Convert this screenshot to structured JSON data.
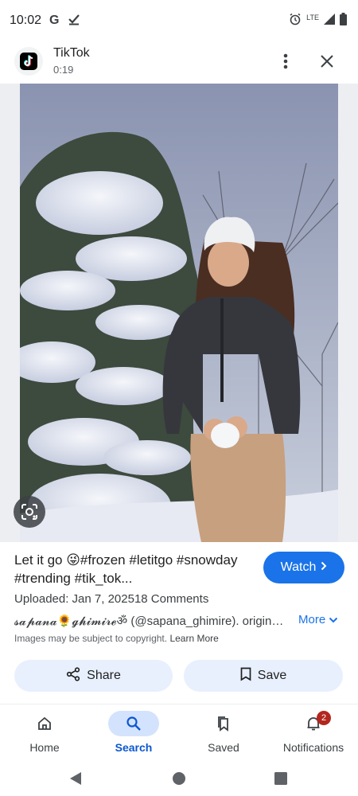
{
  "status_bar": {
    "time": "10:02",
    "g_label": "G",
    "network": "LTE"
  },
  "header": {
    "app_name": "TikTok",
    "duration": "0:19",
    "icons": {
      "more": "more-vert-icon",
      "close": "close-icon"
    }
  },
  "image": {
    "description_icon": "lens-icon"
  },
  "details": {
    "caption": "Let it go 😜#frozen #letitgo #snowday #trending #tik_tok...",
    "watch_label": "Watch",
    "uploaded": "Uploaded: Jan 7, 202518 Comments",
    "source": "𝓼𝓪𝓹𝓪𝓷𝓪🌻𝓰𝓱𝓲𝓶𝓲𝓻𝓮ॐ (@sapana_ghimire). original...",
    "more_label": "More",
    "copyright_text": "Images may be subject to copyright.",
    "learn_more": "Learn More",
    "share_label": "Share",
    "save_label": "Save"
  },
  "bottom_nav": {
    "items": [
      {
        "label": "Home",
        "icon": "home-icon"
      },
      {
        "label": "Search",
        "icon": "search-icon",
        "active": true
      },
      {
        "label": "Saved",
        "icon": "saved-icon"
      },
      {
        "label": "Notifications",
        "icon": "bell-icon",
        "badge": "2"
      }
    ]
  },
  "colors": {
    "accent": "#1a73e8",
    "pill_bg": "#e8f0fe",
    "nav_active_bg": "#d3e3fd",
    "badge": "#b3261e"
  }
}
